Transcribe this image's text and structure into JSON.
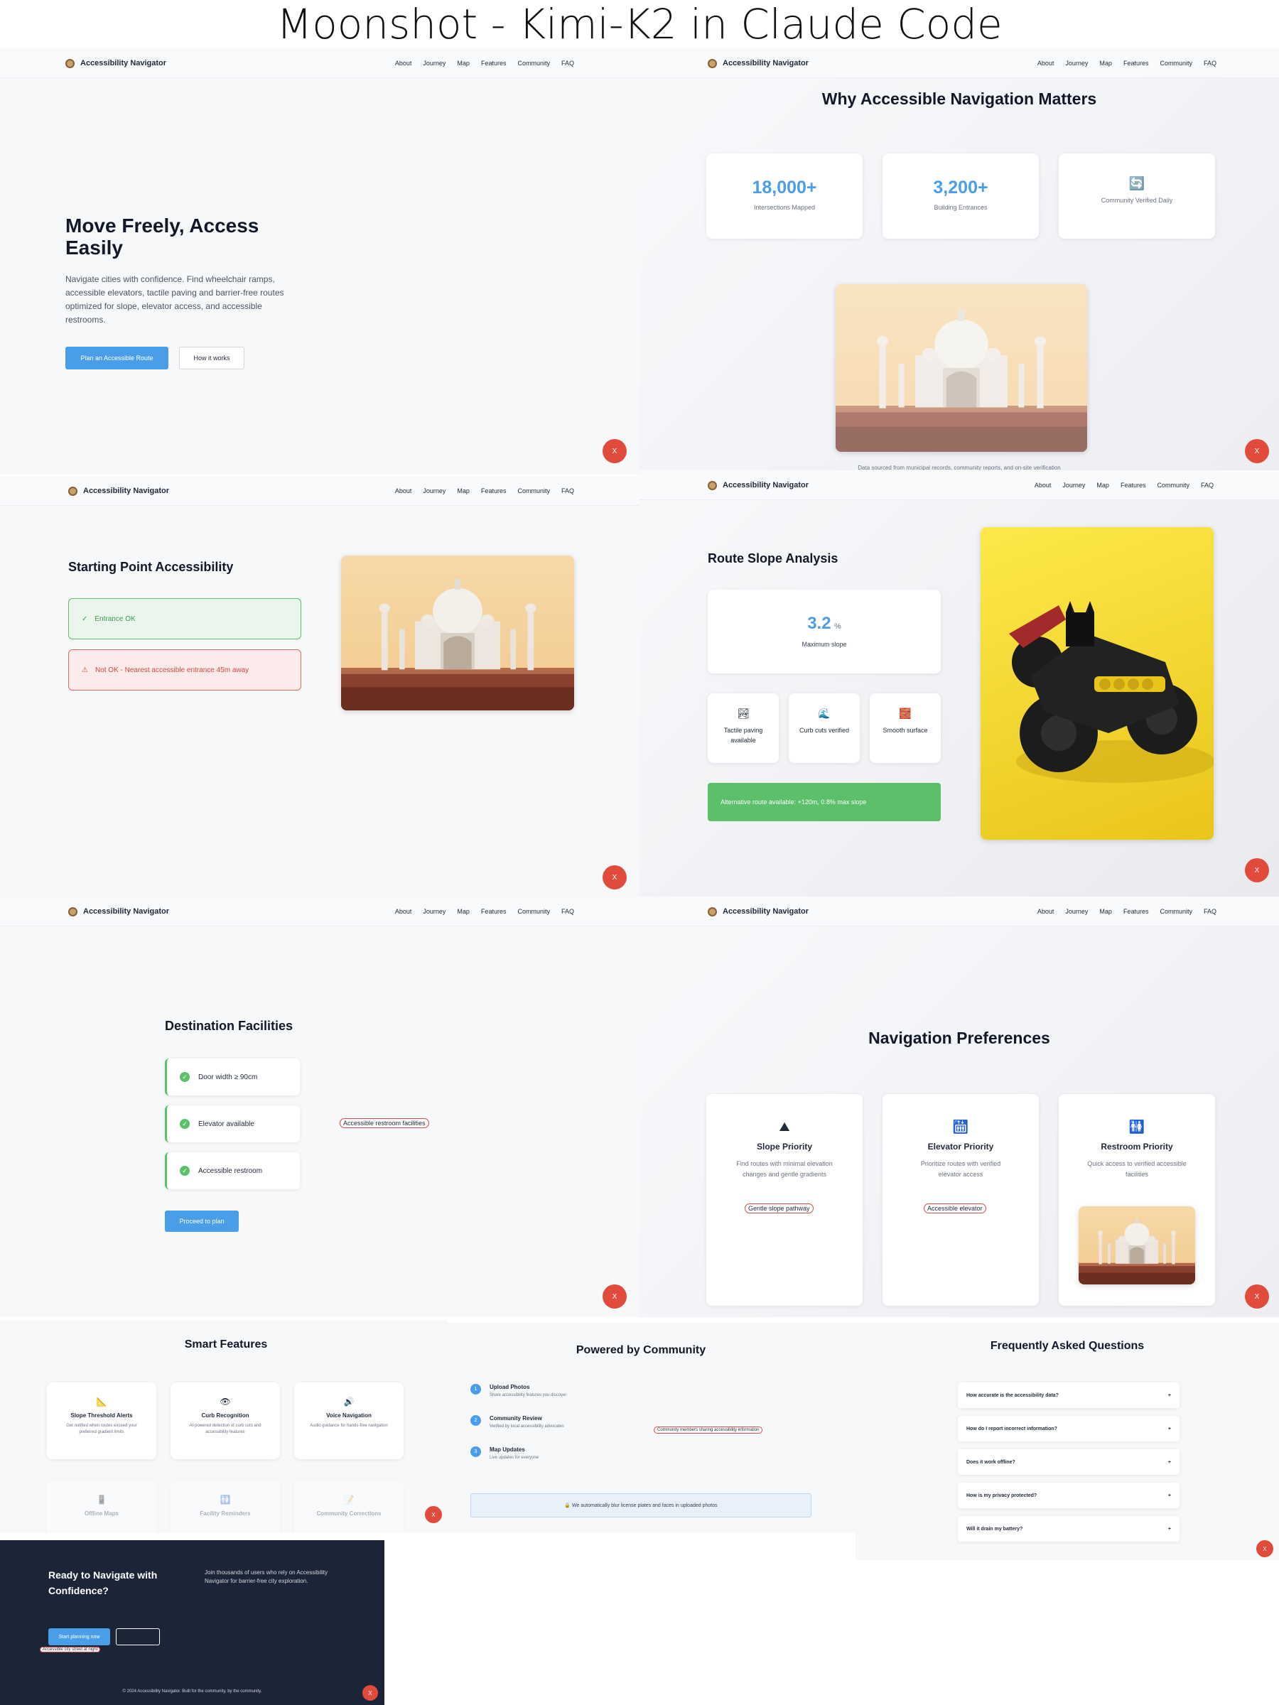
{
  "title": "Moonshot - Kimi-K2 in Claude Code",
  "brand": "Accessibility Navigator",
  "nav": [
    "About",
    "Journey",
    "Map",
    "Features",
    "Community",
    "FAQ"
  ],
  "close_label": "X",
  "hero": {
    "heading": "Move Freely, Access Easily",
    "text": "Navigate cities with confidence. Find wheelchair ramps, accessible elevators, tactile paving and barrier-free routes optimized for slope, elevator access, and accessible restrooms.",
    "primary": "Plan an Accessible Route",
    "secondary": "How it works"
  },
  "why": {
    "heading": "Why Accessible Navigation Matters",
    "stats": [
      {
        "value": "18,000+",
        "label": "Intersections Mapped"
      },
      {
        "value": "3,200+",
        "label": "Building Entrances"
      },
      {
        "value": "🔄",
        "label": "Community Verified Daily"
      }
    ],
    "caption": "Data sourced from municipal records, community reports, and on-site verification"
  },
  "start": {
    "heading": "Starting Point Accessibility",
    "ok": "Entrance OK",
    "notok": "Not OK - Nearest accessible entrance 45m away",
    "ok_icon": "✓",
    "warn_icon": "⚠"
  },
  "slope": {
    "heading": "Route Slope Analysis",
    "value": "3.2",
    "unit": "%",
    "value_label": "Maximum slope",
    "features": [
      {
        "icon": "🏞",
        "label": "Tactile paving available"
      },
      {
        "icon": "🌊",
        "label": "Curb cuts verified"
      },
      {
        "icon": "🧱",
        "label": "Smooth surface"
      }
    ],
    "alt_route": "Alternative route available: +120m, 0.8% max slope"
  },
  "dest": {
    "heading": "Destination Facilities",
    "items": [
      "Door width ≥ 90cm",
      "Elevator available",
      "Accessible restroom"
    ],
    "img_alt": "Accessible restroom facilities",
    "proceed": "Proceed to plan"
  },
  "prefs": {
    "heading": "Navigation Preferences",
    "cards": [
      {
        "icon": "⛰",
        "title": "Slope Priority",
        "text": "Find routes with minimal elevation changes and gentle gradients",
        "img_alt": "Gentle slope pathway"
      },
      {
        "icon": "🛗",
        "title": "Elevator Priority",
        "text": "Prioritize routes with verified elevator access",
        "img_alt": "Accessible elevator"
      },
      {
        "icon": "🚻",
        "title": "Restroom Priority",
        "text": "Quick access to verified accessible facilities"
      }
    ]
  },
  "smart": {
    "heading": "Smart Features",
    "cards": [
      {
        "icon": "📐",
        "title": "Slope Threshold Alerts",
        "text": "Get notified when routes exceed your preferred gradient limits"
      },
      {
        "icon": "👁",
        "title": "Curb Recognition",
        "text": "AI-powered detection of curb cuts and accessibility features"
      },
      {
        "icon": "🔊",
        "title": "Voice Navigation",
        "text": "Audio guidance for hands-free navigation"
      },
      {
        "icon": "📱",
        "title": "Offline Maps",
        "text": ""
      },
      {
        "icon": "🚻",
        "title": "Facility Reminders",
        "text": ""
      },
      {
        "icon": "📝",
        "title": "Community Corrections",
        "text": ""
      }
    ]
  },
  "community": {
    "heading": "Powered by Community",
    "steps": [
      {
        "n": "1",
        "title": "Upload Photos",
        "text": "Share accessibility features you discover"
      },
      {
        "n": "2",
        "title": "Community Review",
        "text": "Verified by local accessibility advocates"
      },
      {
        "n": "3",
        "title": "Map Updates",
        "text": "Live updates for everyone"
      }
    ],
    "img_alt": "Community members sharing accessibility information",
    "privacy": "🔒 We automatically blur license plates and faces in uploaded photos"
  },
  "faq": {
    "heading": "Frequently Asked Questions",
    "items": [
      "How accurate is the accessibility data?",
      "How do I report incorrect information?",
      "Does it work offline?",
      "How is my privacy protected?",
      "Will it drain my battery?"
    ],
    "plus": "+"
  },
  "cta": {
    "heading": "Ready to Navigate with Confidence?",
    "text": "Join thousands of users who rely on Accessibility Navigator for barrier-free city exploration.",
    "button": "Start planning now",
    "img_alt": "Accessible city street at night",
    "footer": "© 2024 Accessibility Navigator. Built for the community, by the community."
  }
}
